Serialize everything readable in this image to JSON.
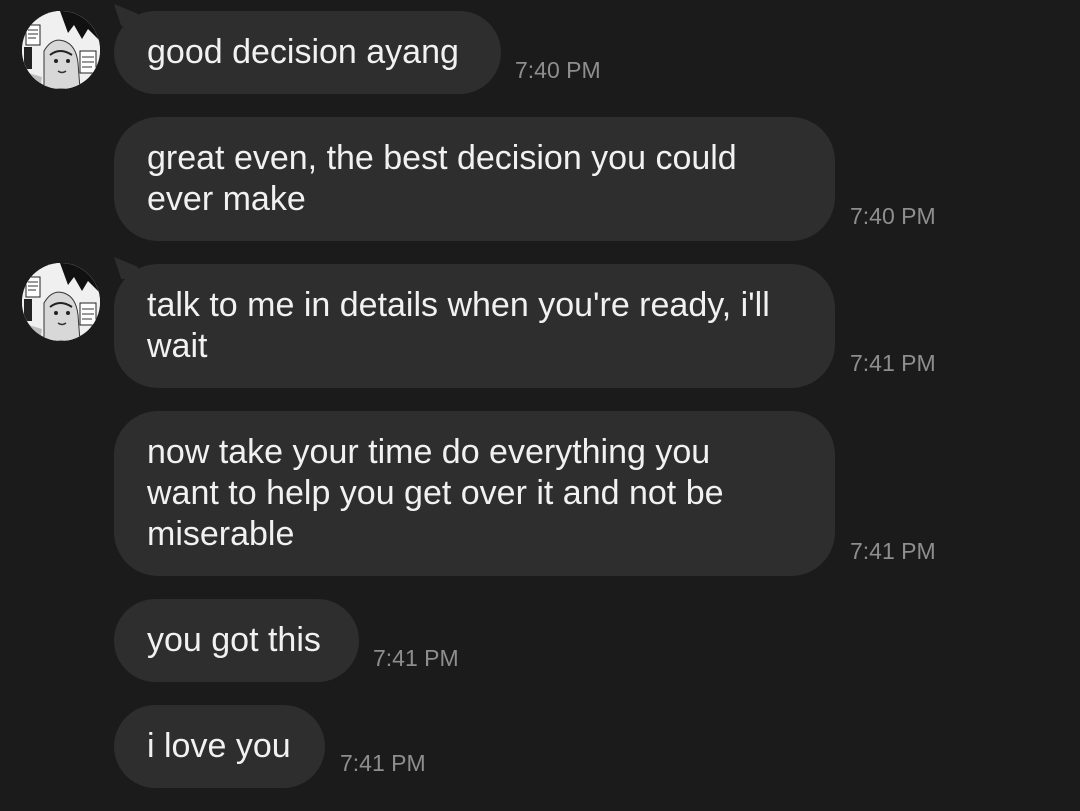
{
  "messages": [
    {
      "text": "good decision ayang",
      "time": "7:40 PM"
    },
    {
      "text": "great even, the best decision you could\never make",
      "time": "7:40 PM"
    },
    {
      "text": "talk to me in details when you're ready, i'll\nwait",
      "time": "7:41 PM"
    },
    {
      "text": "now take your time do everything you\nwant to help you get over it and not be\nmiserable",
      "time": "7:41 PM"
    },
    {
      "text": "you got this",
      "time": "7:41 PM"
    },
    {
      "text": "i love you",
      "time": "7:41 PM"
    }
  ],
  "colors": {
    "background": "#1b1b1b",
    "bubble": "#2e2e2e",
    "text": "#f1f1f1",
    "timestamp": "#8e8e8e"
  }
}
